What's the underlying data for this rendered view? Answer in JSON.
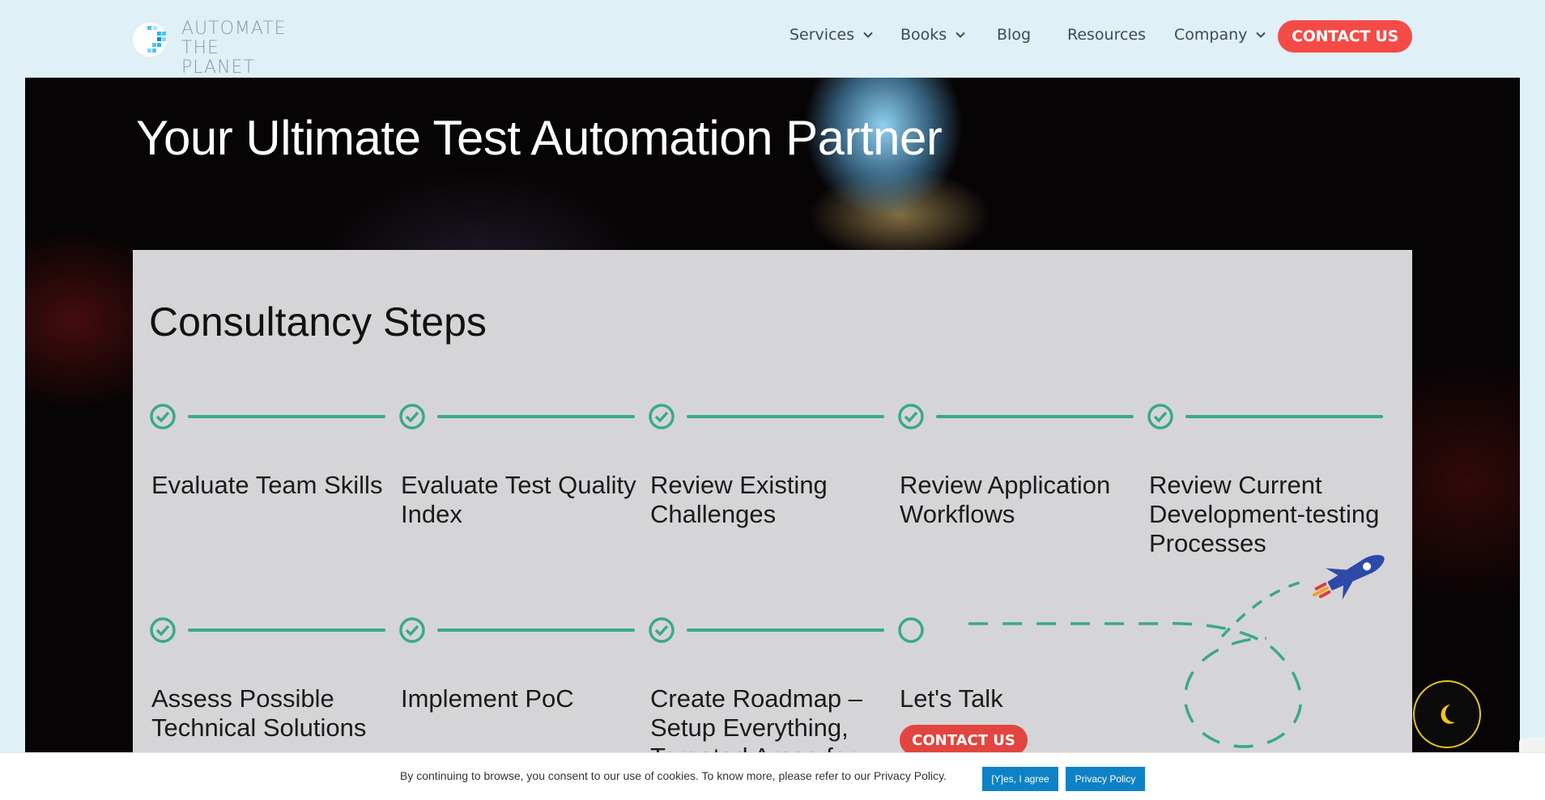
{
  "header": {
    "logo": {
      "line1": "AUTOMATE",
      "line2": "THE PLANET",
      "icon": "planet-dots-logo"
    },
    "nav": [
      {
        "label": "Services",
        "has_dropdown": true
      },
      {
        "label": "Books",
        "has_dropdown": true
      },
      {
        "label": "Blog",
        "has_dropdown": false
      },
      {
        "label": "Resources",
        "has_dropdown": false
      },
      {
        "label": "Company",
        "has_dropdown": true
      }
    ],
    "contact_label": "CONTACT US"
  },
  "hero": {
    "title": "Your Ultimate Test Automation Partner"
  },
  "consultancy": {
    "title": "Consultancy Steps",
    "row1": [
      {
        "label": "Evaluate Team Skills",
        "status": "done"
      },
      {
        "label": "Evaluate Test Quality Index",
        "status": "done"
      },
      {
        "label": "Review Existing Challenges",
        "status": "done"
      },
      {
        "label": "Review Application Workflows",
        "status": "done"
      },
      {
        "label": "Review Current Development-testing Processes",
        "status": "done"
      }
    ],
    "row2": [
      {
        "label": "Assess Possible Technical Solutions",
        "status": "done"
      },
      {
        "label": "Implement PoC",
        "status": "done"
      },
      {
        "label": "Create Roadmap – Setup Everything, Targeted Areas for",
        "status": "done"
      },
      {
        "label": "Let's Talk",
        "status": "pending"
      }
    ],
    "talk_button": "CONTACT US"
  },
  "cookie": {
    "text": "By continuing to browse, you consent to our use of cookies. To know more, please refer to our Privacy Policy.",
    "agree_label": "[Y]es, I agree",
    "policy_label": "Privacy Policy"
  },
  "theme_toggle": {
    "icon": "moon-icon"
  },
  "colors": {
    "accent_red": "#f44b47",
    "step_green": "#3aa88c",
    "cookie_blue": "#0d82c7",
    "header_bg": "#dff0f7"
  }
}
